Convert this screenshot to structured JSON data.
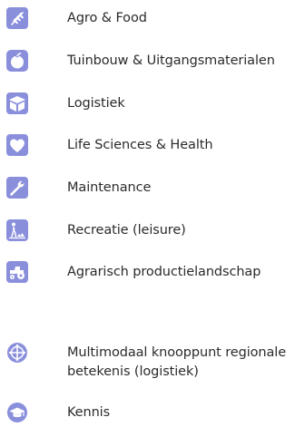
{
  "legend": {
    "accent_color": "#8a8fdc",
    "items": [
      {
        "label": "Agro & Food",
        "icon": "wheat-icon"
      },
      {
        "label": "Tuinbouw & Uitgangsmaterialen",
        "icon": "fruit-icon"
      },
      {
        "label": "Logistiek",
        "icon": "box-icon"
      },
      {
        "label": "Life Sciences & Health",
        "icon": "heart-icon"
      },
      {
        "label": "Maintenance",
        "icon": "wrench-icon"
      },
      {
        "label": "Recreatie (leisure)",
        "icon": "leisure-icon"
      },
      {
        "label": "Agrarisch productielandschap",
        "icon": "tractor-icon"
      },
      {
        "label": "Multimodaal knooppunt regionale betekenis (logistiek)",
        "icon": "multimodal-node-icon"
      },
      {
        "label": "Kennis",
        "icon": "graduation-cap-icon"
      }
    ]
  }
}
